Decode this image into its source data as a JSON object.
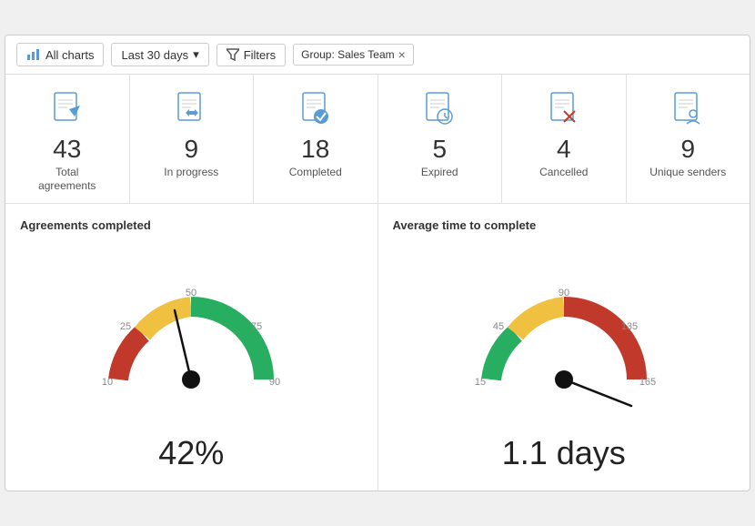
{
  "toolbar": {
    "all_charts_label": "All charts",
    "date_range_label": "Last 30 days",
    "filters_label": "Filters",
    "group_tag_label": "Group: Sales Team",
    "close_label": "×"
  },
  "stats": [
    {
      "id": "total-agreements",
      "number": "43",
      "label": "Total\nagreements",
      "icon": "send"
    },
    {
      "id": "in-progress",
      "number": "9",
      "label": "In progress",
      "icon": "arrows"
    },
    {
      "id": "completed",
      "number": "18",
      "label": "Completed",
      "icon": "check"
    },
    {
      "id": "expired",
      "number": "5",
      "label": "Expired",
      "icon": "clock"
    },
    {
      "id": "cancelled",
      "number": "4",
      "label": "Cancelled",
      "icon": "x"
    },
    {
      "id": "unique-senders",
      "number": "9",
      "label": "Unique senders",
      "icon": "person"
    }
  ],
  "charts": [
    {
      "id": "agreements-completed",
      "title": "Agreements completed",
      "value": "42%",
      "type": "gauge",
      "needle_angle": -110
    },
    {
      "id": "avg-time-complete",
      "title": "Average time to complete",
      "value": "1.1 days",
      "type": "gauge",
      "needle_angle": 30
    }
  ],
  "colors": {
    "red": "#c0392b",
    "yellow": "#f0c040",
    "green": "#27ae60",
    "text_dark": "#222",
    "border": "#e0e0e0"
  }
}
